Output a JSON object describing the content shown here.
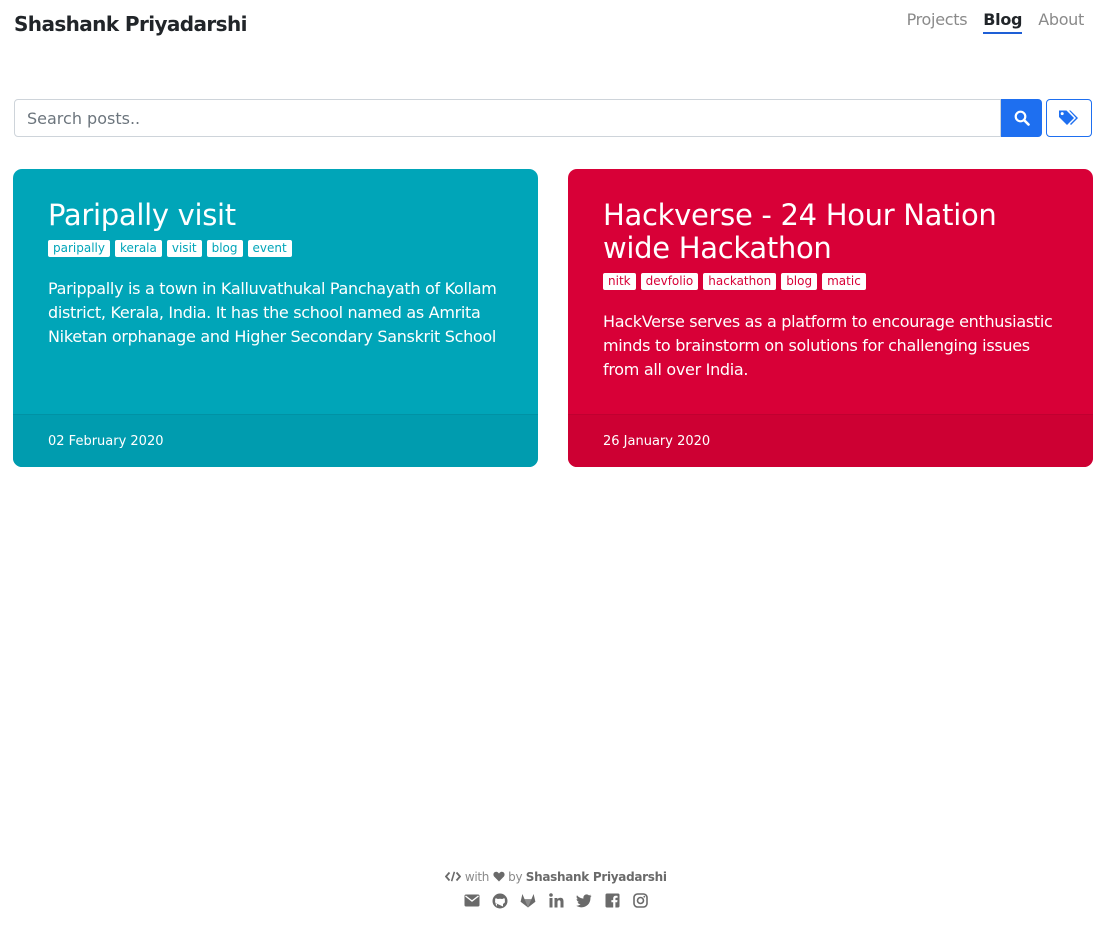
{
  "header": {
    "brand": "Shashank Priyadarshi",
    "nav": [
      {
        "label": "Projects"
      },
      {
        "label": "Blog"
      },
      {
        "label": "About"
      }
    ]
  },
  "search": {
    "placeholder": "Search posts..",
    "value": ""
  },
  "posts": [
    {
      "title": "Paripally visit",
      "tags": [
        "paripally",
        "kerala",
        "visit",
        "blog",
        "event"
      ],
      "description": "Parippally is a town in Kalluvathukal Panchayath of Kollam district, Kerala, India. It has the school named as Amrita Niketan orphanage and Higher Secondary Sanskrit School",
      "date": "02 February 2020",
      "color": "#00a5b8",
      "footer_color": "#009caf"
    },
    {
      "title": "Hackverse - 24 Hour Nation wide Hackathon",
      "tags": [
        "nitk",
        "devfolio",
        "hackathon",
        "blog",
        "matic"
      ],
      "description": "HackVerse serves as a platform to encourage enthusiastic minds to brainstorm on solutions for challenging issues from all over India.",
      "date": "26 January 2020",
      "color": "#d80037",
      "footer_color": "#cd0033"
    }
  ],
  "footer": {
    "with": "with",
    "by": "by",
    "author": "Shashank Priyadarshi",
    "social_icons": [
      "envelope-icon",
      "github-icon",
      "gitlab-icon",
      "linkedin-icon",
      "twitter-icon",
      "facebook-icon",
      "instagram-icon"
    ]
  },
  "colors": {
    "accent": "#1e6ff0",
    "muted": "#8a8a8a"
  }
}
